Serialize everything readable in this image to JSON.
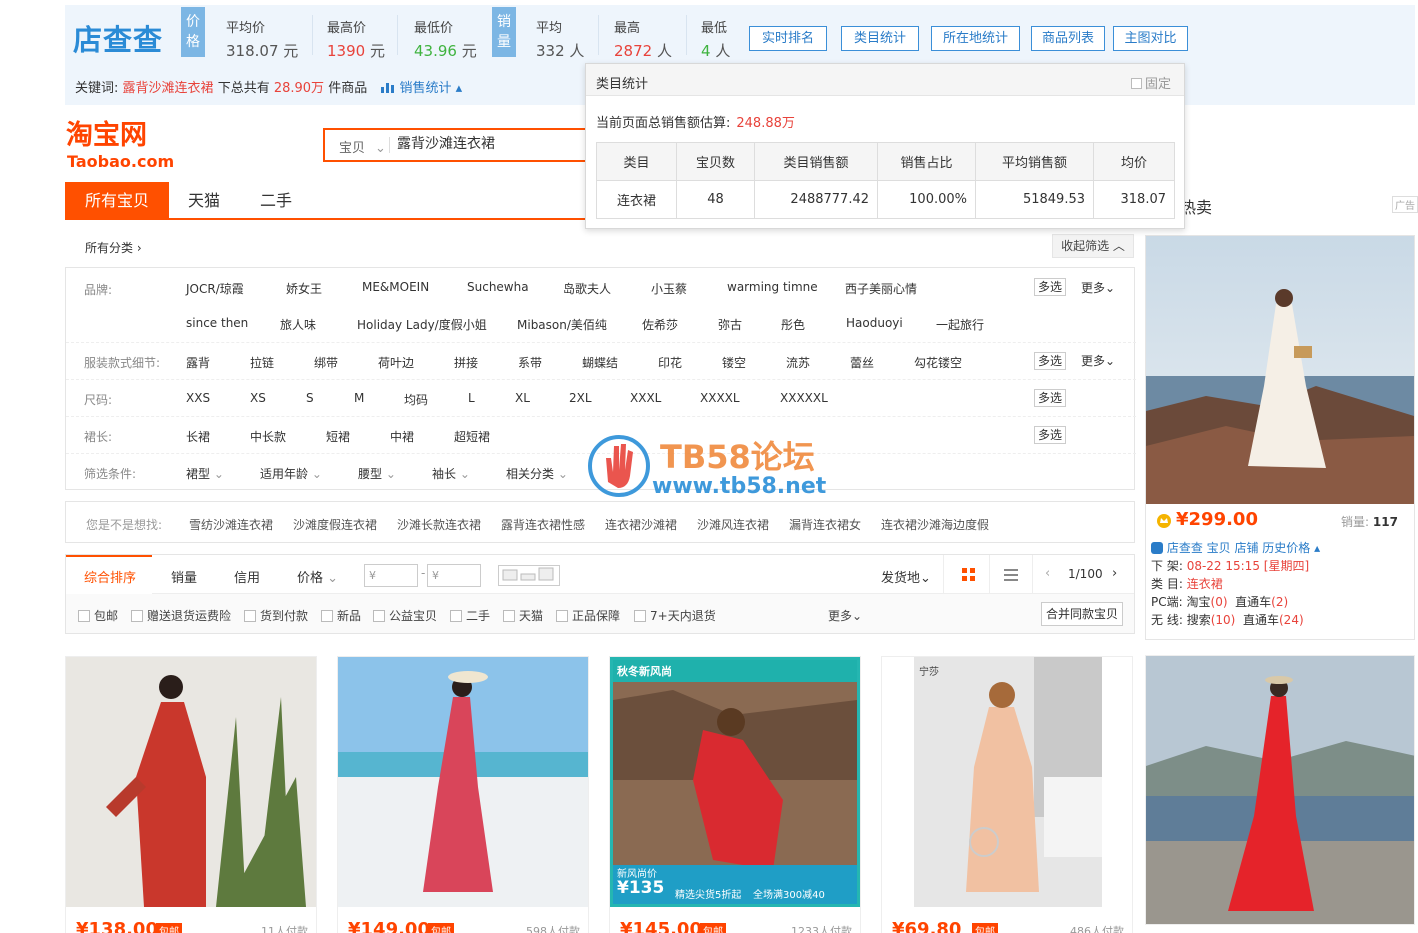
{
  "plugin": {
    "logo": "店查查",
    "price_tag": "价格",
    "avg_price_label": "平均价",
    "avg_price_value": "318.07",
    "avg_price_unit": "元",
    "max_price_label": "最高价",
    "max_price_value": "1390",
    "max_price_unit": "元",
    "min_price_label": "最低价",
    "min_price_value": "43.96",
    "min_price_unit": "元",
    "sales_tag": "销量",
    "avg_sales_label": "平均",
    "avg_sales_value": "332",
    "avg_sales_unit": "人",
    "max_sales_label": "最高",
    "max_sales_value": "2872",
    "max_sales_unit": "人",
    "min_sales_label": "最低",
    "min_sales_value": "4",
    "min_sales_unit": "人",
    "buttons": [
      "实时排名",
      "类目统计",
      "所在地统计",
      "商品列表",
      "主图对比"
    ],
    "kw_label": "关键词:",
    "keyword": "露背沙滩连衣裙",
    "total_prefix": "下总共有",
    "total_value": "28.90万",
    "total_suffix": "件商品",
    "sales_stats": "销售统计"
  },
  "popup": {
    "title": "类目统计",
    "fixed_label": "固定",
    "estimate_label": "当前页面总销售额估算:",
    "estimate_value": "248.88万",
    "headers": [
      "类目",
      "宝贝数",
      "类目销售额",
      "销售占比",
      "平均销售额",
      "均价"
    ],
    "row": [
      "连衣裙",
      "48",
      "2488777.42",
      "100.00%",
      "51849.53",
      "318.07"
    ]
  },
  "taobao": {
    "logo": "淘宝网",
    "logo_en": "Taobao.com",
    "search_category": "宝贝",
    "search_value": "露背沙滩连衣裙",
    "tabs": [
      "所有宝贝",
      "天猫",
      "二手"
    ],
    "hot_sale": "热卖",
    "ad_tag": "广告",
    "all_categories": "所有分类 ›",
    "collapse": "收起筛选 ︿"
  },
  "filters": {
    "brand_label": "品牌:",
    "brands_row1": [
      "JOCR/琼霞",
      "娇女王",
      "ME&MOEIN",
      "Suchewha",
      "岛歌夫人",
      "小玉蔡",
      "warming timne",
      "西子美丽心情"
    ],
    "brands_row2": [
      "since then",
      "旅人味",
      "Holiday Lady/度假小姐",
      "Mibason/美佰纯",
      "佐希莎",
      "弥古",
      "彤色",
      "Haoduoyi",
      "一起旅行"
    ],
    "detail_label": "服装款式细节:",
    "details": [
      "露背",
      "拉链",
      "绑带",
      "荷叶边",
      "拼接",
      "系带",
      "蝴蝶结",
      "印花",
      "镂空",
      "流苏",
      "蕾丝",
      "勾花镂空"
    ],
    "size_label": "尺码:",
    "sizes": [
      "XXS",
      "XS",
      "S",
      "M",
      "均码",
      "L",
      "XL",
      "2XL",
      "XXXL",
      "XXXXL",
      "XXXXXL"
    ],
    "length_label": "裙长:",
    "lengths": [
      "长裙",
      "中长款",
      "短裙",
      "中裙",
      "超短裙"
    ],
    "cond_label": "筛选条件:",
    "conditions": [
      "裙型",
      "适用年龄",
      "腰型",
      "袖长",
      "相关分类"
    ],
    "multi": "多选",
    "more": "更多⌄"
  },
  "suggest": {
    "label": "您是不是想找:",
    "items": [
      "雪纺沙滩连衣裙",
      "沙滩度假连衣裙",
      "沙滩长款连衣裙",
      "露背连衣裙性感",
      "连衣裙沙滩裙",
      "沙滩风连衣裙",
      "漏背连衣裙女",
      "连衣裙沙滩海边度假"
    ]
  },
  "sortbar": {
    "sorts": [
      "综合排序",
      "销量",
      "信用",
      "价格"
    ],
    "price_from": "¥",
    "price_to": "¥",
    "ship_from": "发货地⌄",
    "page": "1/100",
    "checks": [
      "包邮",
      "赠送退货运费险",
      "货到付款",
      "新品",
      "公益宝贝",
      "二手",
      "天猫",
      "正品保障",
      "7+天内退货"
    ],
    "more": "更多⌄",
    "merge": "合并同款宝贝"
  },
  "ad": {
    "price": "¥299.00",
    "sales_label": "销量:",
    "sales_value": "117",
    "plugin_line": "店查查 宝贝 店铺 历史价格",
    "offshelf_label": "下 架:",
    "offshelf_value": "08-22 15:15 [星期四]",
    "cat_label": "类 目:",
    "cat_value": "连衣裙",
    "pc_label": "PC端:",
    "pc_a": "淘宝",
    "pc_a_val": "(0)",
    "pc_b": "直通车",
    "pc_b_val": "(2)",
    "wl_label": "无 线:",
    "wl_a": "搜索",
    "wl_a_val": "(10)",
    "wl_b": "直通车",
    "wl_b_val": "(24)"
  },
  "products": [
    {
      "price": "¥138.00",
      "sold": "11人付款"
    },
    {
      "price": "¥149.00",
      "sold": "598人付款"
    },
    {
      "price": "¥145.00",
      "sold": "1233人付款",
      "banner_top": "秋冬新风尚",
      "banner_price": "新风尚价",
      "banner_num": "¥135",
      "banner_a": "精选尖货5折起",
      "banner_b": "全场满300减40"
    },
    {
      "price": "¥69.80",
      "sold": "486人付款",
      "brand": "宁莎"
    }
  ],
  "product_tag": "包邮",
  "watermark": {
    "title": "TB58论坛",
    "url": "www.tb58.net"
  },
  "colors": {
    "accent": "#ff5000",
    "plugin_blue": "#2a7cc8",
    "plugin_bg": "#eef5fc",
    "red": "#e8433b",
    "green": "#3fb33f"
  }
}
